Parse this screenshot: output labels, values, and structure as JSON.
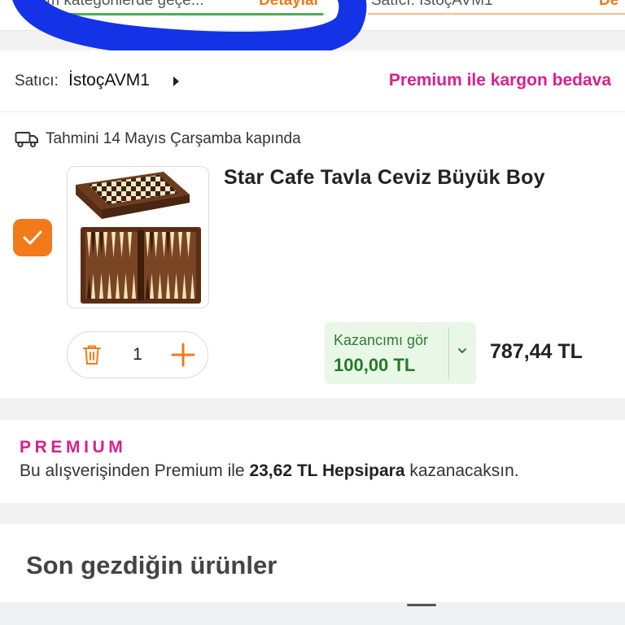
{
  "top_bar": {
    "left_text": "ım kategorilerde geçe...",
    "details_label": "Detaylar",
    "seller_fragment": "Satıcı: İstoçAVM1",
    "right_fragment": "De",
    "progress": 0.99,
    "colors": {
      "accent": "#f27a1a",
      "progress": "#4caf50"
    }
  },
  "seller": {
    "prefix": "Satıcı:",
    "name": "İstoçAVM1",
    "premium_cargo": "Premium ile kargon bedava"
  },
  "delivery": {
    "icon": "truck-icon",
    "text": "Tahmini 14 Mayıs Çarşamba kapında"
  },
  "product": {
    "selected": true,
    "title": "Star Cafe Tavla Ceviz Büyük Boy",
    "quantity": "1",
    "gain_label": "Kazancımı gör",
    "gain_amount": "100,00 TL",
    "price": "787,44 TL"
  },
  "premium": {
    "badge": "PREMIUM",
    "text_before": "Bu alışverişinden Premium ile ",
    "text_bold": "23,62 TL Hepsipara",
    "text_after": " kazanacaksın."
  },
  "recent": {
    "title": "Son gezdiğin ürünler"
  },
  "colors": {
    "brand_orange": "#f27a1a",
    "premium_pink": "#d91f8c",
    "gain_green": "#237a2a",
    "gain_bg": "#e9f7e7",
    "scribble_blue": "#1432e6"
  }
}
